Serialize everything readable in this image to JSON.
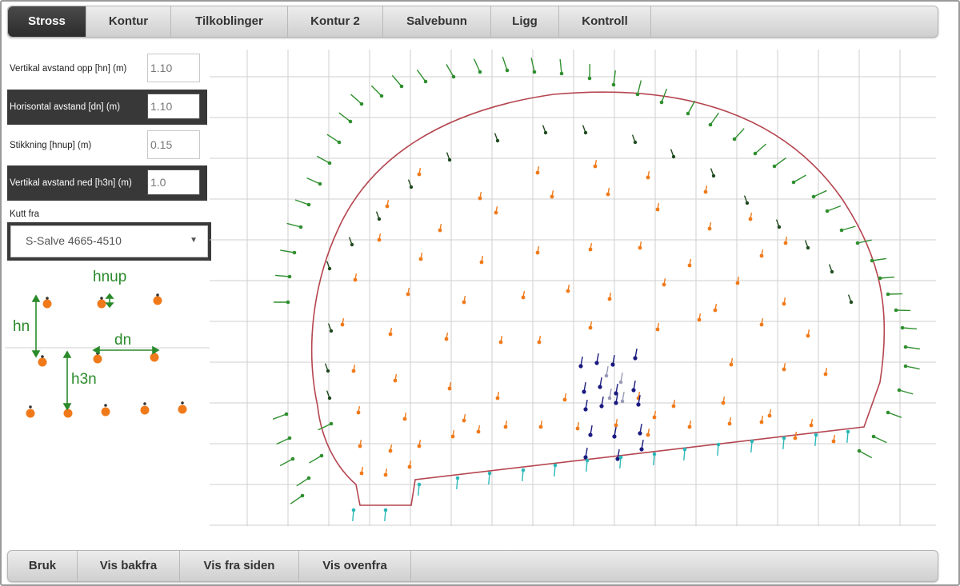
{
  "tabs": [
    {
      "label": "Stross",
      "active": true
    },
    {
      "label": "Kontur",
      "active": false
    },
    {
      "label": "Tilkoblinger",
      "active": false
    },
    {
      "label": "Kontur 2",
      "active": false
    },
    {
      "label": "Salvebunn",
      "active": false
    },
    {
      "label": "Ligg",
      "active": false
    },
    {
      "label": "Kontroll",
      "active": false
    }
  ],
  "form": {
    "vertical_up": {
      "label": "Vertikal avstand opp [hn] (m)",
      "value": "1.10"
    },
    "horizontal": {
      "label": "Horisontal avstand [dn] (m)",
      "value": "1.10"
    },
    "stikkning": {
      "label": "Stikkning [hnup] (m)",
      "value": "0.15"
    },
    "vertical_down": {
      "label": "Vertikal avstand ned [h3n] (m)",
      "value": "1.0"
    },
    "kutt_fra": {
      "label": "Kutt fra",
      "value": "S-Salve 4665-4510"
    }
  },
  "legend": {
    "hnup": "hnup",
    "hn": "hn",
    "dn": "dn",
    "h3n": "h3n",
    "green": "#2a8a2a",
    "orange": "#f07a1a"
  },
  "diagram": {
    "profile_color": "#b5454f",
    "grid_color": "#cfcfcf",
    "colors": {
      "contour": "#2f8f2f",
      "inner_contour": "#1f4a1f",
      "stross": "#f07a1a",
      "cut": "#1a1a80",
      "cut_light": "#9a9ab5",
      "floor": "#2bb8b8"
    }
  },
  "bottom": [
    {
      "label": "Bruk"
    },
    {
      "label": "Vis bakfra"
    },
    {
      "label": "Vis fra siden"
    },
    {
      "label": "Vis ovenfra"
    }
  ]
}
